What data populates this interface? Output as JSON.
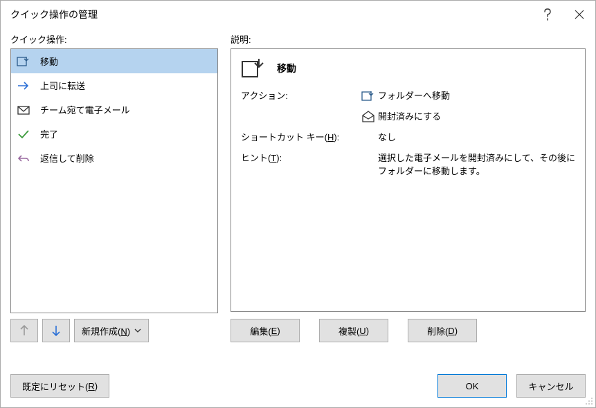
{
  "titlebar": {
    "title": "クイック操作の管理"
  },
  "left": {
    "label": "クイック操作:",
    "items": [
      {
        "label": "移動",
        "icon": "move-to-folder"
      },
      {
        "label": "上司に転送",
        "icon": "forward-arrow"
      },
      {
        "label": "チーム宛て電子メール",
        "icon": "envelope"
      },
      {
        "label": "完了",
        "icon": "check"
      },
      {
        "label": "返信して削除",
        "icon": "reply-undo"
      }
    ],
    "new_btn": "新規作成(N)"
  },
  "right": {
    "label": "説明:",
    "title": "移動",
    "rows": {
      "action_label": "アクション:",
      "action1": "フォルダーへ移動",
      "action2": "開封済みにする",
      "shortcut_label": "ショートカット キー(H):",
      "shortcut_value": "なし",
      "hint_label": "ヒント(T):",
      "hint_value": "選択した電子メールを開封済みにして、その後にフォルダーに移動します。"
    },
    "buttons": {
      "edit": "編集(E)",
      "duplicate": "複製(U)",
      "delete": "削除(D)"
    }
  },
  "footer": {
    "reset": "既定にリセット(R)",
    "ok": "OK",
    "cancel": "キャンセル"
  }
}
